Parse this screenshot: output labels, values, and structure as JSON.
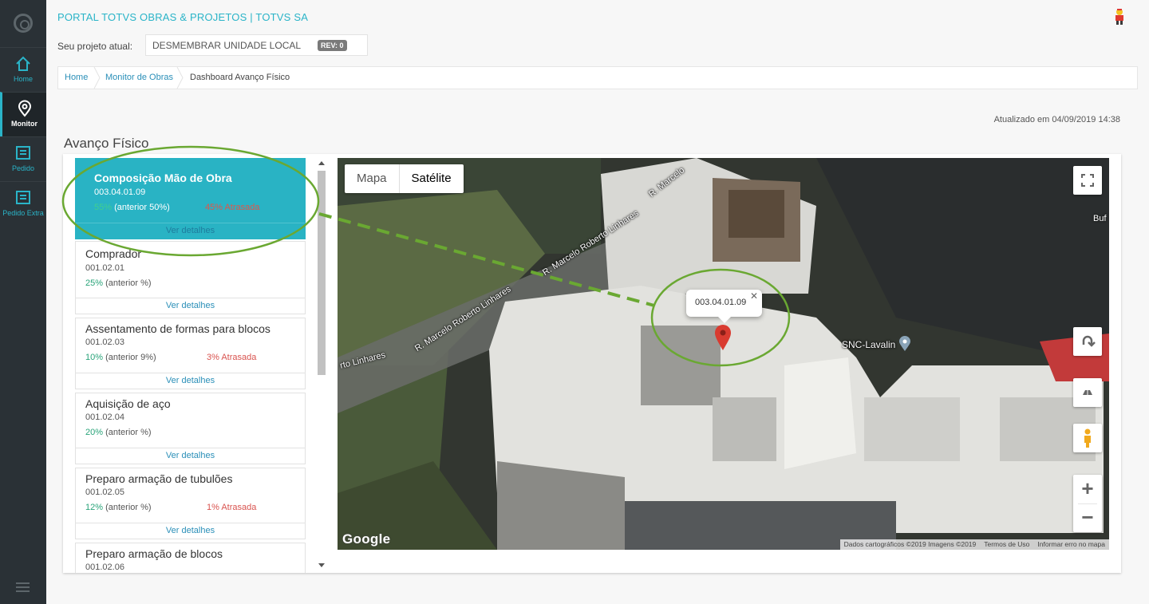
{
  "sidebar": {
    "items": [
      {
        "label": "Home",
        "icon": "home-icon"
      },
      {
        "label": "Monitor",
        "icon": "location-pin-icon"
      },
      {
        "label": "Pedido",
        "icon": "document-list-icon"
      },
      {
        "label": "Pedido Extra",
        "icon": "document-list-icon"
      }
    ]
  },
  "header": {
    "portal_title": "PORTAL TOTVS OBRAS & PROJETOS | TOTVS SA",
    "project_label": "Seu projeto atual:",
    "project_name": "DESMEMBRAR UNIDADE LOCAL",
    "revision": "REV: 0"
  },
  "breadcrumb": [
    "Home",
    "Monitor de Obras",
    "Dashboard Avanço Físico"
  ],
  "updated": "Atualizado em 04/09/2019 14:38",
  "section_title": "Avanço Físico",
  "tasks": [
    {
      "name": "Composição Mão de Obra",
      "code": "003.04.01.09",
      "pct": "55%",
      "prev": "(anterior 50%)",
      "late": "45% Atrasada",
      "details": "Ver detalhes"
    },
    {
      "name": "Comprador",
      "code": "001.02.01",
      "pct": "25%",
      "prev": "(anterior %)",
      "late": "",
      "details": "Ver detalhes"
    },
    {
      "name": "Assentamento de formas para blocos",
      "code": "001.02.03",
      "pct": "10%",
      "prev": "(anterior 9%)",
      "late": "3% Atrasada",
      "details": "Ver detalhes"
    },
    {
      "name": "Aquisição de aço",
      "code": "001.02.04",
      "pct": "20%",
      "prev": "(anterior %)",
      "late": "",
      "details": "Ver detalhes"
    },
    {
      "name": "Preparo armação de tubulões",
      "code": "001.02.05",
      "pct": "12%",
      "prev": "(anterior %)",
      "late": "1% Atrasada",
      "details": "Ver detalhes"
    },
    {
      "name": "Preparo armação de blocos",
      "code": "001.02.06",
      "pct": "",
      "prev": "",
      "late": "",
      "details": ""
    }
  ],
  "map": {
    "toggle_map": "Mapa",
    "toggle_satellite": "Satélite",
    "marker_label": "003.04.01.09",
    "poi": "SNC-Lavalin",
    "streets": [
      "R. Marcelo",
      "R. Marcelo Roberto Linhares",
      "R. Marcelo Roberto Linhares",
      "R. Marcelo Roberto Linhares",
      "rto Linhares"
    ],
    "edge_label": "Buf",
    "google": "Google",
    "attribution": [
      "Dados cartográficos ©2019 Imagens ©2019",
      "Termos de Uso",
      "Informar erro no mapa"
    ]
  },
  "colors": {
    "accent": "#29b3c4",
    "sidebar": "#2a3136",
    "late": "#d9534f",
    "progress": "#2aa47a",
    "annotation": "#6aa832"
  }
}
